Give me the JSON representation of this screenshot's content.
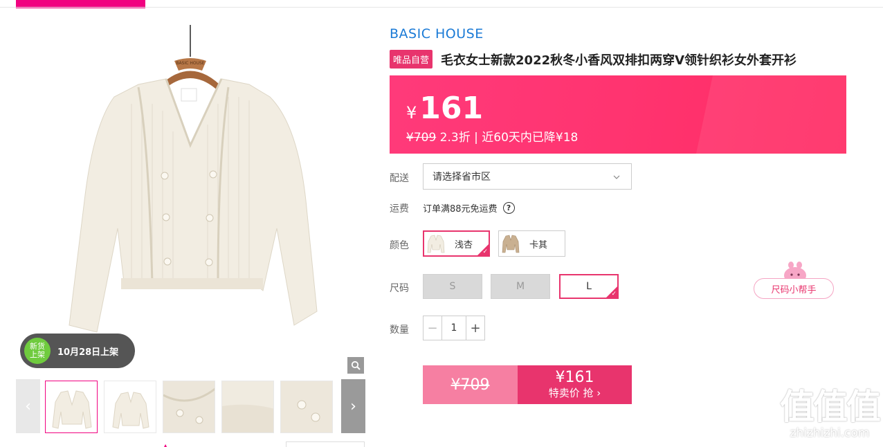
{
  "gallery": {
    "hanger_brand": "BASIC HOUSE",
    "new_badge_line1": "新货",
    "new_badge_line2": "上架",
    "new_date": "10月28日上架",
    "prev_arrow": "‹",
    "next_arrow": "›"
  },
  "product": {
    "brand": "BASIC HOUSE",
    "self_tag": "唯品自营",
    "title": "毛衣女士新款2022秋冬小香风双排扣两穿V领针织衫女外套开衫"
  },
  "price": {
    "currency": "¥",
    "current": "161",
    "original": "¥709",
    "discount": "2.3折",
    "separator": "|",
    "history": "近60天内已降¥18"
  },
  "delivery": {
    "label": "配送",
    "placeholder": "请选择省市区"
  },
  "shipping": {
    "label": "运费",
    "text": "订单满88元免运费",
    "help": "?"
  },
  "color": {
    "label": "颜色",
    "options": [
      {
        "name": "浅杏",
        "selected": true
      },
      {
        "name": "卡其",
        "selected": false
      }
    ]
  },
  "size": {
    "label": "尺码",
    "options": [
      {
        "name": "S",
        "available": false
      },
      {
        "name": "M",
        "available": false
      },
      {
        "name": "L",
        "available": true,
        "selected": true
      }
    ],
    "helper": "尺码小帮手"
  },
  "quantity": {
    "label": "数量",
    "minus": "−",
    "value": "1",
    "plus": "+"
  },
  "buy": {
    "original": "¥709",
    "price": "¥161",
    "action": "特卖价 抢 ›"
  },
  "watermark": {
    "chars": "值值值",
    "domain": "zhizhizhi.com"
  },
  "colors": {
    "accent": "#e8346d",
    "brand_blue": "#1a7ad6",
    "price_bg": "#ff3470",
    "new_green": "#6fcb3e"
  }
}
